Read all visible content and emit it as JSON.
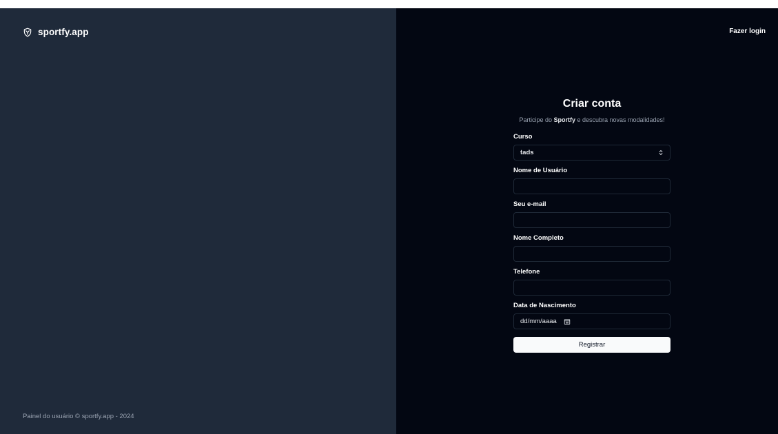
{
  "brand": {
    "name": "sportfy.app",
    "icon": "shield-logo-icon"
  },
  "footer": {
    "text": "Painel do usuário © sportfy.app - 2024"
  },
  "header": {
    "login_link": "Fazer login"
  },
  "form": {
    "title": "Criar conta",
    "subtitle_pre": "Participe do ",
    "subtitle_brand": "Sportfy",
    "subtitle_post": " e descubra novas modalidades!",
    "course": {
      "label": "Curso",
      "value": "tads",
      "icon": "chevron-updown-icon"
    },
    "username": {
      "label": "Nome de Usuário",
      "value": ""
    },
    "email": {
      "label": "Seu e-mail",
      "value": ""
    },
    "full_name": {
      "label": "Nome Completo",
      "value": ""
    },
    "phone": {
      "label": "Telefone",
      "value": ""
    },
    "birth_date": {
      "label": "Data de Nascimento",
      "placeholder": "dd/mm/aaaa",
      "icon": "calendar-icon"
    },
    "submit_label": "Registrar"
  },
  "colors": {
    "left_panel": "#1f2a3a",
    "right_panel": "#030712",
    "button_bg": "#f9fafb",
    "input_border": "#1f2937"
  }
}
